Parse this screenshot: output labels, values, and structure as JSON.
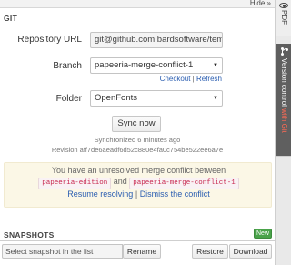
{
  "topbar": {
    "hide_label": "Hide »"
  },
  "side_tabs": {
    "pdf_label": "PDF",
    "version_control_label": "Version control",
    "version_control_suffix": "with Git"
  },
  "git": {
    "section_title": "GIT",
    "repository_label": "Repository URL",
    "repository_value": "git@github.com:bardsoftware/temp",
    "branch_label": "Branch",
    "branch_value": "papeeria-merge-conflict-1",
    "checkout_label": "Checkout",
    "separator": "|",
    "refresh_label": "Refresh",
    "folder_label": "Folder",
    "folder_value": "OpenFonts",
    "sync_label": "Sync now",
    "synchronized_text": "Synchronized 6 minutes ago",
    "revision_text": "Revision aff7de6aeadf6d52c880e4fa0c754be522ee6a7e"
  },
  "conflict": {
    "message": "You have an unresolved merge conflict between",
    "branch_a": "papeeria-edition",
    "and_text": "and",
    "branch_b": "papeeria-merge-conflict-1",
    "resume_label": "Resume resolving",
    "separator": "|",
    "dismiss_label": "Dismiss the conflict"
  },
  "snapshots": {
    "section_title": "SNAPSHOTS",
    "new_label": "New",
    "select_placeholder": "Select snapshot in the list",
    "rename_label": "Rename",
    "restore_label": "Restore",
    "download_label": "Download"
  }
}
